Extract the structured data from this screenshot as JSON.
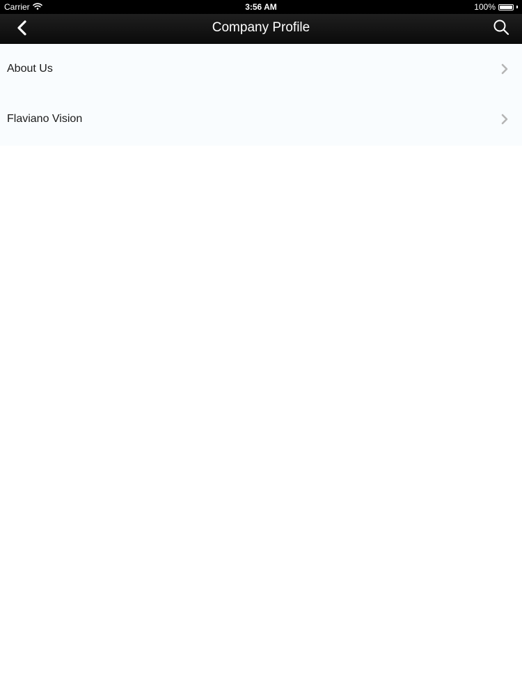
{
  "status_bar": {
    "carrier": "Carrier",
    "time": "3:56 AM",
    "battery": "100%",
    "battery_level": 1.0
  },
  "nav_bar": {
    "title": "Company Profile",
    "back_icon": "chevron-left-icon",
    "search_icon": "search-icon"
  },
  "menu": {
    "items": [
      {
        "label": "About Us"
      },
      {
        "label": "Flaviano Vision"
      }
    ]
  },
  "colors": {
    "nav_background": "#141414",
    "list_background": "#f9fcfe",
    "chevron": "#b5b5b5",
    "text": "#1a1a1a"
  }
}
